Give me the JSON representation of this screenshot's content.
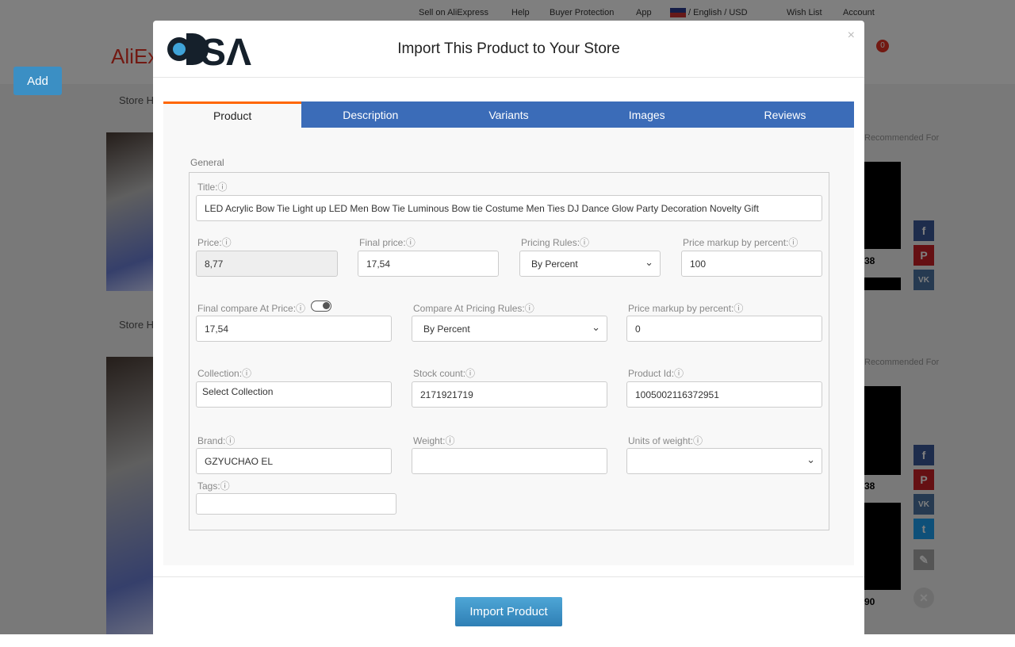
{
  "background": {
    "topbar": [
      "Sell on AliExpress",
      "Help",
      "Buyer Protection",
      "App",
      "/ English /  USD",
      "Wish List",
      "Account"
    ],
    "logo": "AliExpress",
    "add_button": "Add",
    "store_nav": "Store Home",
    "recommended": "Recommended For",
    "prices": [
      "38",
      "38",
      "90"
    ],
    "cart_count": "0"
  },
  "modal": {
    "logo": "DSA",
    "title": "Import This Product to Your Store",
    "close": "×",
    "tabs": [
      {
        "label": "Product",
        "active": true
      },
      {
        "label": "Description"
      },
      {
        "label": "Variants"
      },
      {
        "label": "Images"
      },
      {
        "label": "Reviews"
      }
    ],
    "section": "General",
    "fields": {
      "title": {
        "label": "Title:ⓘ",
        "value": "LED Acrylic Bow Tie Light up LED Men Bow Tie Luminous Bow tie Costume Men Ties DJ Dance Glow Party Decoration Novelty Gift"
      },
      "price": {
        "label": "Price:ⓘ",
        "value": "8,77"
      },
      "final_price": {
        "label": "Final price:ⓘ",
        "value": "17,54"
      },
      "pricing_rules": {
        "label": "Pricing Rules:ⓘ",
        "value": "By Percent"
      },
      "markup": {
        "label": "Price markup by percent:ⓘ",
        "value": "100"
      },
      "compare_price": {
        "label": "Final compare At Price:ⓘ",
        "value": "17,54",
        "toggle_on": true
      },
      "compare_rules": {
        "label": "Compare At Pricing Rules:ⓘ",
        "value": "By Percent"
      },
      "compare_markup": {
        "label": "Price markup by percent:ⓘ",
        "value": "0"
      },
      "collection": {
        "label": "Collection:ⓘ",
        "value": "Select Collection"
      },
      "stock": {
        "label": "Stock count:ⓘ",
        "value": "2171921719"
      },
      "product_id": {
        "label": "Product Id:ⓘ",
        "value": "1005002116372951"
      },
      "brand": {
        "label": "Brand:ⓘ",
        "value": "GZYUCHAO EL"
      },
      "weight": {
        "label": "Weight:ⓘ",
        "value": ""
      },
      "units": {
        "label": "Units of weight:ⓘ",
        "value": ""
      },
      "tags": {
        "label": "Tags:ⓘ",
        "value": ""
      }
    },
    "import_button": "Import Product"
  },
  "colors": {
    "tab_bar": "#3b6cb8",
    "active_tab_border": "#ff6600",
    "import_button": "#3a8fc4"
  }
}
